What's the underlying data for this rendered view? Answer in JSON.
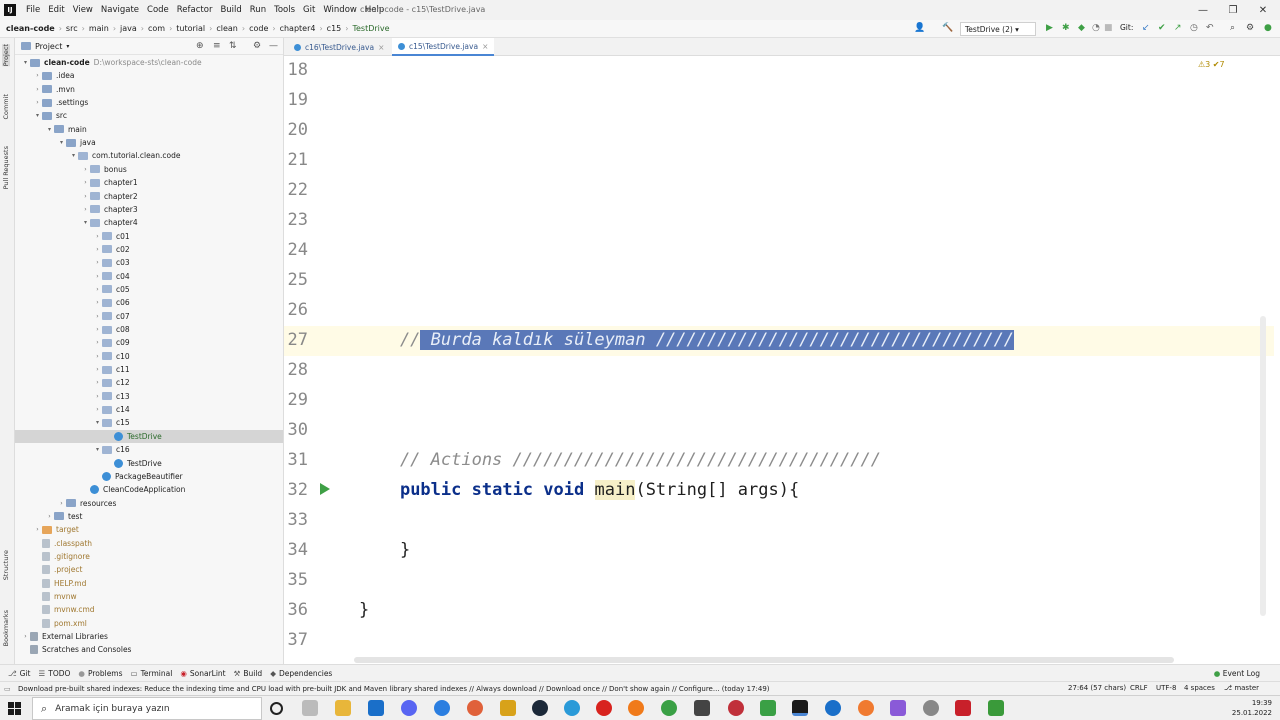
{
  "titlebar": {
    "app_icon": "IJ",
    "menu": [
      "File",
      "Edit",
      "View",
      "Navigate",
      "Code",
      "Refactor",
      "Build",
      "Run",
      "Tools",
      "Git",
      "Window",
      "Help"
    ],
    "title": "clean-code - c15\\TestDrive.java",
    "minimize": "—",
    "maximize": "❐",
    "close": "✕"
  },
  "navbar": {
    "breadcrumbs": [
      "clean-code",
      "src",
      "main",
      "java",
      "com",
      "tutorial",
      "clean",
      "code",
      "chapter4",
      "c15",
      "TestDrive"
    ],
    "run_config": "TestDrive (2)",
    "git_label": "Git:"
  },
  "stripe": {
    "project": "Project",
    "commit": "Commit",
    "pull_requests": "Pull Requests",
    "structure": "Structure",
    "bookmarks": "Bookmarks"
  },
  "project_panel": {
    "header": "Project",
    "tree": [
      {
        "label": "clean-code",
        "path": "D:\\workspace-sts\\clean-code",
        "depth": 0,
        "arrow": "v",
        "icon": "folder",
        "bold": true
      },
      {
        "label": ".idea",
        "depth": 1,
        "arrow": ">",
        "icon": "folder"
      },
      {
        "label": ".mvn",
        "depth": 1,
        "arrow": ">",
        "icon": "folder"
      },
      {
        "label": ".settings",
        "depth": 1,
        "arrow": ">",
        "icon": "folder"
      },
      {
        "label": "src",
        "depth": 1,
        "arrow": "v",
        "icon": "folder"
      },
      {
        "label": "main",
        "depth": 2,
        "arrow": "v",
        "icon": "folder"
      },
      {
        "label": "java",
        "depth": 3,
        "arrow": "v",
        "icon": "folder"
      },
      {
        "label": "com.tutorial.clean.code",
        "depth": 4,
        "arrow": "v",
        "icon": "pkg"
      },
      {
        "label": "bonus",
        "depth": 5,
        "arrow": ">",
        "icon": "pkg"
      },
      {
        "label": "chapter1",
        "depth": 5,
        "arrow": ">",
        "icon": "pkg"
      },
      {
        "label": "chapter2",
        "depth": 5,
        "arrow": ">",
        "icon": "pkg"
      },
      {
        "label": "chapter3",
        "depth": 5,
        "arrow": ">",
        "icon": "pkg"
      },
      {
        "label": "chapter4",
        "depth": 5,
        "arrow": "v",
        "icon": "pkg"
      },
      {
        "label": "c01",
        "depth": 6,
        "arrow": ">",
        "icon": "pkg"
      },
      {
        "label": "c02",
        "depth": 6,
        "arrow": ">",
        "icon": "pkg"
      },
      {
        "label": "c03",
        "depth": 6,
        "arrow": ">",
        "icon": "pkg"
      },
      {
        "label": "c04",
        "depth": 6,
        "arrow": ">",
        "icon": "pkg"
      },
      {
        "label": "c05",
        "depth": 6,
        "arrow": ">",
        "icon": "pkg"
      },
      {
        "label": "c06",
        "depth": 6,
        "arrow": ">",
        "icon": "pkg"
      },
      {
        "label": "c07",
        "depth": 6,
        "arrow": ">",
        "icon": "pkg"
      },
      {
        "label": "c08",
        "depth": 6,
        "arrow": ">",
        "icon": "pkg"
      },
      {
        "label": "c09",
        "depth": 6,
        "arrow": ">",
        "icon": "pkg"
      },
      {
        "label": "c10",
        "depth": 6,
        "arrow": ">",
        "icon": "pkg"
      },
      {
        "label": "c11",
        "depth": 6,
        "arrow": ">",
        "icon": "pkg"
      },
      {
        "label": "c12",
        "depth": 6,
        "arrow": ">",
        "icon": "pkg"
      },
      {
        "label": "c13",
        "depth": 6,
        "arrow": ">",
        "icon": "pkg"
      },
      {
        "label": "c14",
        "depth": 6,
        "arrow": ">",
        "icon": "pkg"
      },
      {
        "label": "c15",
        "depth": 6,
        "arrow": "v",
        "icon": "pkg"
      },
      {
        "label": "TestDrive",
        "depth": 7,
        "arrow": "",
        "icon": "java",
        "selected": true
      },
      {
        "label": "c16",
        "depth": 6,
        "arrow": "v",
        "icon": "pkg"
      },
      {
        "label": "TestDrive",
        "depth": 7,
        "arrow": "",
        "icon": "java"
      },
      {
        "label": "PackageBeautifier",
        "depth": 6,
        "arrow": "",
        "icon": "java"
      },
      {
        "label": "CleanCodeApplication",
        "depth": 5,
        "arrow": "",
        "icon": "java"
      },
      {
        "label": "resources",
        "depth": 3,
        "arrow": ">",
        "icon": "folder"
      },
      {
        "label": "test",
        "depth": 2,
        "arrow": ">",
        "icon": "folder"
      },
      {
        "label": "target",
        "depth": 1,
        "arrow": ">",
        "icon": "orange"
      },
      {
        "label": ".classpath",
        "depth": 1,
        "arrow": "",
        "icon": "file"
      },
      {
        "label": ".gitignore",
        "depth": 1,
        "arrow": "",
        "icon": "file"
      },
      {
        "label": ".project",
        "depth": 1,
        "arrow": "",
        "icon": "file"
      },
      {
        "label": "HELP.md",
        "depth": 1,
        "arrow": "",
        "icon": "file"
      },
      {
        "label": "mvnw",
        "depth": 1,
        "arrow": "",
        "icon": "file"
      },
      {
        "label": "mvnw.cmd",
        "depth": 1,
        "arrow": "",
        "icon": "file"
      },
      {
        "label": "pom.xml",
        "depth": 1,
        "arrow": "",
        "icon": "file"
      },
      {
        "label": "External Libraries",
        "depth": 0,
        "arrow": ">",
        "icon": "lib"
      },
      {
        "label": "Scratches and Consoles",
        "depth": 0,
        "arrow": "",
        "icon": "lib"
      }
    ]
  },
  "tabs": [
    {
      "label": "c16\\TestDrive.java",
      "active": false
    },
    {
      "label": "c15\\TestDrive.java",
      "active": true
    }
  ],
  "editor": {
    "warnings": "⚠3  ✔7",
    "lines": [
      {
        "n": "18",
        "code": ""
      },
      {
        "n": "19",
        "code": ""
      },
      {
        "n": "20",
        "code": ""
      },
      {
        "n": "21",
        "code": ""
      },
      {
        "n": "22",
        "code": ""
      },
      {
        "n": "23",
        "code": ""
      },
      {
        "n": "24",
        "code": ""
      },
      {
        "n": "25",
        "code": ""
      },
      {
        "n": "26",
        "code": ""
      },
      {
        "n": "27",
        "code": "special27"
      },
      {
        "n": "28",
        "code": ""
      },
      {
        "n": "29",
        "code": ""
      },
      {
        "n": "30",
        "code": ""
      },
      {
        "n": "31",
        "code": "special31"
      },
      {
        "n": "32",
        "code": "special32"
      },
      {
        "n": "33",
        "code": ""
      },
      {
        "n": "34",
        "code": "special34"
      },
      {
        "n": "35",
        "code": ""
      },
      {
        "n": "36",
        "code": "special36"
      },
      {
        "n": "37",
        "code": ""
      }
    ],
    "line27_prefix": "    //",
    "line27_selected": " Burda kaldık süleyman ///////////////////////////////////",
    "line31": "    // Actions ////////////////////////////////////",
    "line32_indent": "    ",
    "line32_kw1": "public",
    "line32_kw2": "static",
    "line32_kw3": "void",
    "line32_method": "main",
    "line32_rest": "(String[] args){",
    "line34": "    }",
    "line36": "}"
  },
  "bottom_tools": [
    "Git",
    "TODO",
    "Problems",
    "Terminal",
    "SonarLint",
    "Build",
    "Dependencies"
  ],
  "event_log": "Event Log",
  "status": {
    "message": "Download pre-built shared indexes: Reduce the indexing time and CPU load with pre-built JDK and Maven library shared indexes // Always download // Download once // Don't show again // Configure... (today 17:49)",
    "position": "27:64 (57 chars)",
    "line_sep": "CRLF",
    "encoding": "UTF-8",
    "indent": "4 spaces",
    "branch": "master"
  },
  "taskbar": {
    "search_placeholder": "Aramak için buraya yazın",
    "time": "19:39",
    "date": "25.01.2022"
  },
  "colors": {
    "selection": "#5a78b8",
    "run_green": "#3fa046",
    "current_line": "#fffbe6"
  }
}
